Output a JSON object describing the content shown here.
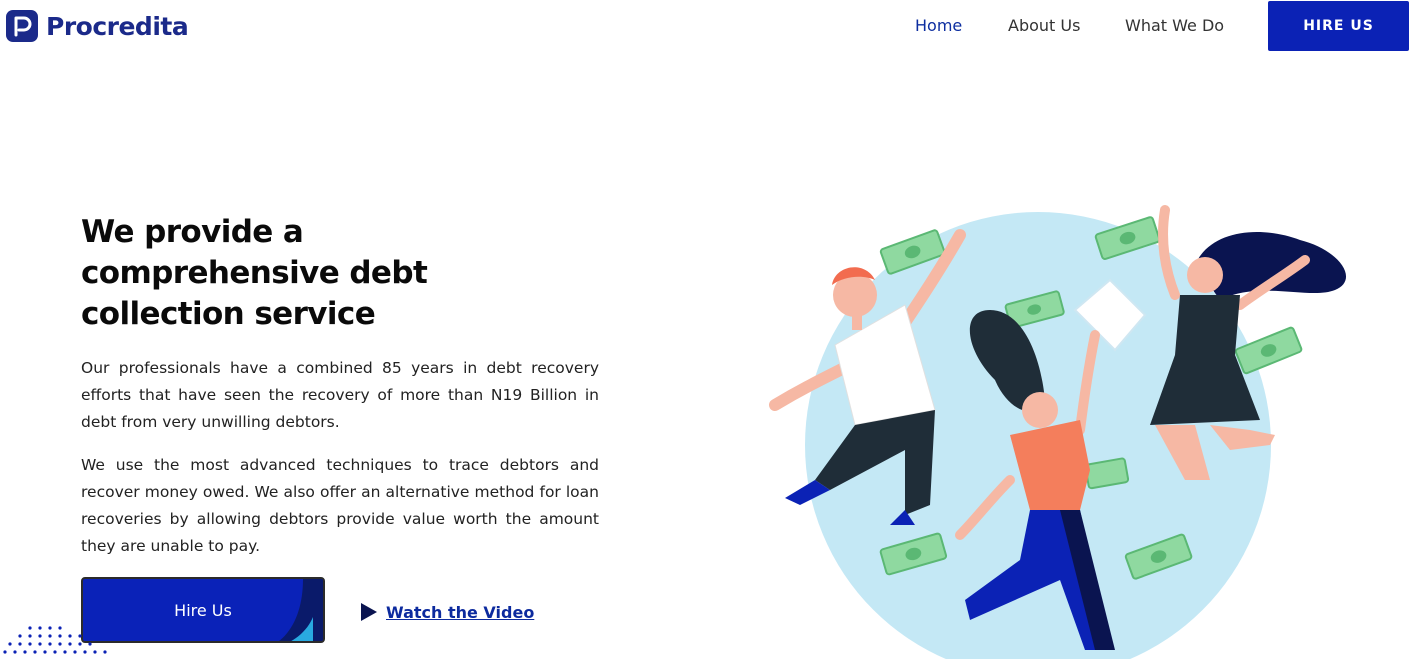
{
  "brand": {
    "name": "Procredita",
    "logo_icon": "p-logo-icon",
    "color": "#1b2a8a"
  },
  "nav": {
    "items": [
      {
        "label": "Home",
        "active": true
      },
      {
        "label": "About Us",
        "active": false
      },
      {
        "label": "What We Do",
        "active": false
      }
    ],
    "cta_label": "HIRE US"
  },
  "hero": {
    "title": "We provide a comprehensive debt collection service",
    "paragraph_1": "Our professionals have a combined 85 years in debt recovery efforts that have seen the recovery of more than N19 Billion in debt from very unwilling debtors.",
    "paragraph_2": "We use the most advanced techniques to trace debtors and recover money owed. We also offer an alternative method for loan recoveries by allowing debtors provide value worth the amount they are unable to pay.",
    "primary_button": "Hire Us",
    "video_link": "Watch the Video",
    "video_icon": "play-icon"
  },
  "colors": {
    "accent": "#0b22b5",
    "link": "#0c2a9e",
    "circle": "#c4e8f5",
    "money": "#8fd9a0"
  }
}
